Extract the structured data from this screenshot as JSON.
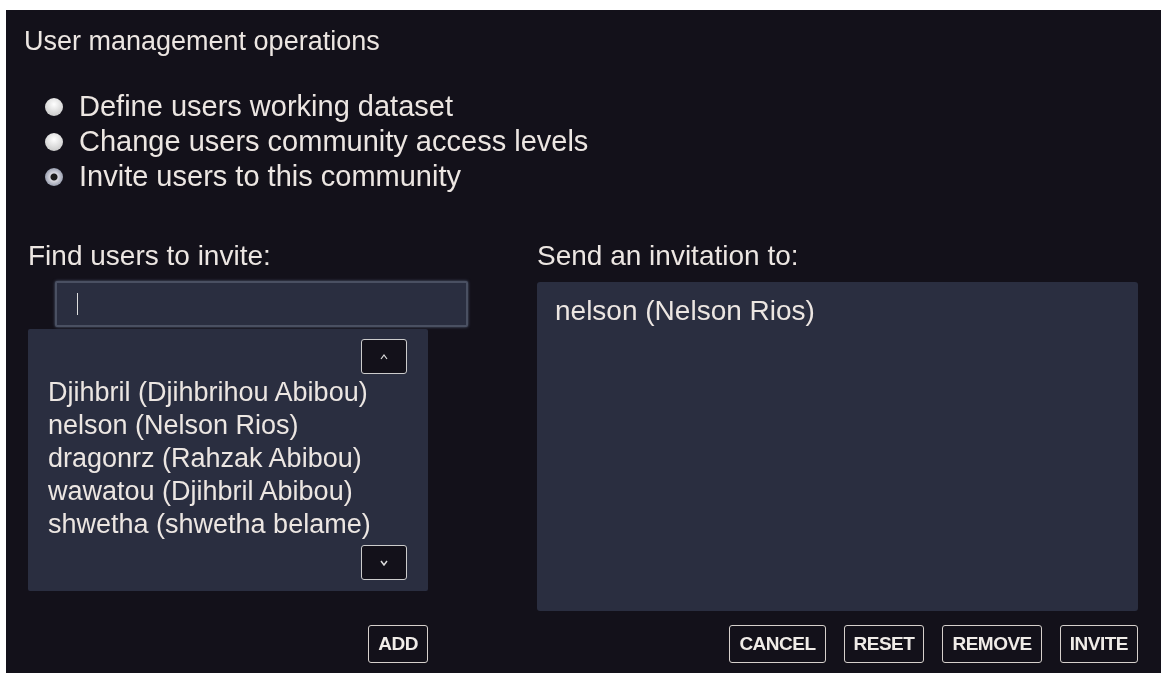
{
  "heading": "User management operations",
  "operations": [
    {
      "label": "Define users working dataset",
      "selected": false
    },
    {
      "label": "Change users community access levels",
      "selected": false
    },
    {
      "label": "Invite users to this community",
      "selected": true
    }
  ],
  "find": {
    "label": "Find users to invite:",
    "results": [
      "Djihbril (Djihbrihou Abibou)",
      "nelson (Nelson Rios)",
      "dragonrz (Rahzak Abibou)",
      "wawatou (Djihbril Abibou)",
      "shwetha (shwetha belame)"
    ],
    "add_button": "ADD"
  },
  "invite": {
    "label": "Send an invitation to:",
    "recipients": [
      "nelson (Nelson Rios)"
    ],
    "buttons": [
      "CANCEL",
      "RESET",
      "REMOVE",
      "INVITE"
    ]
  }
}
